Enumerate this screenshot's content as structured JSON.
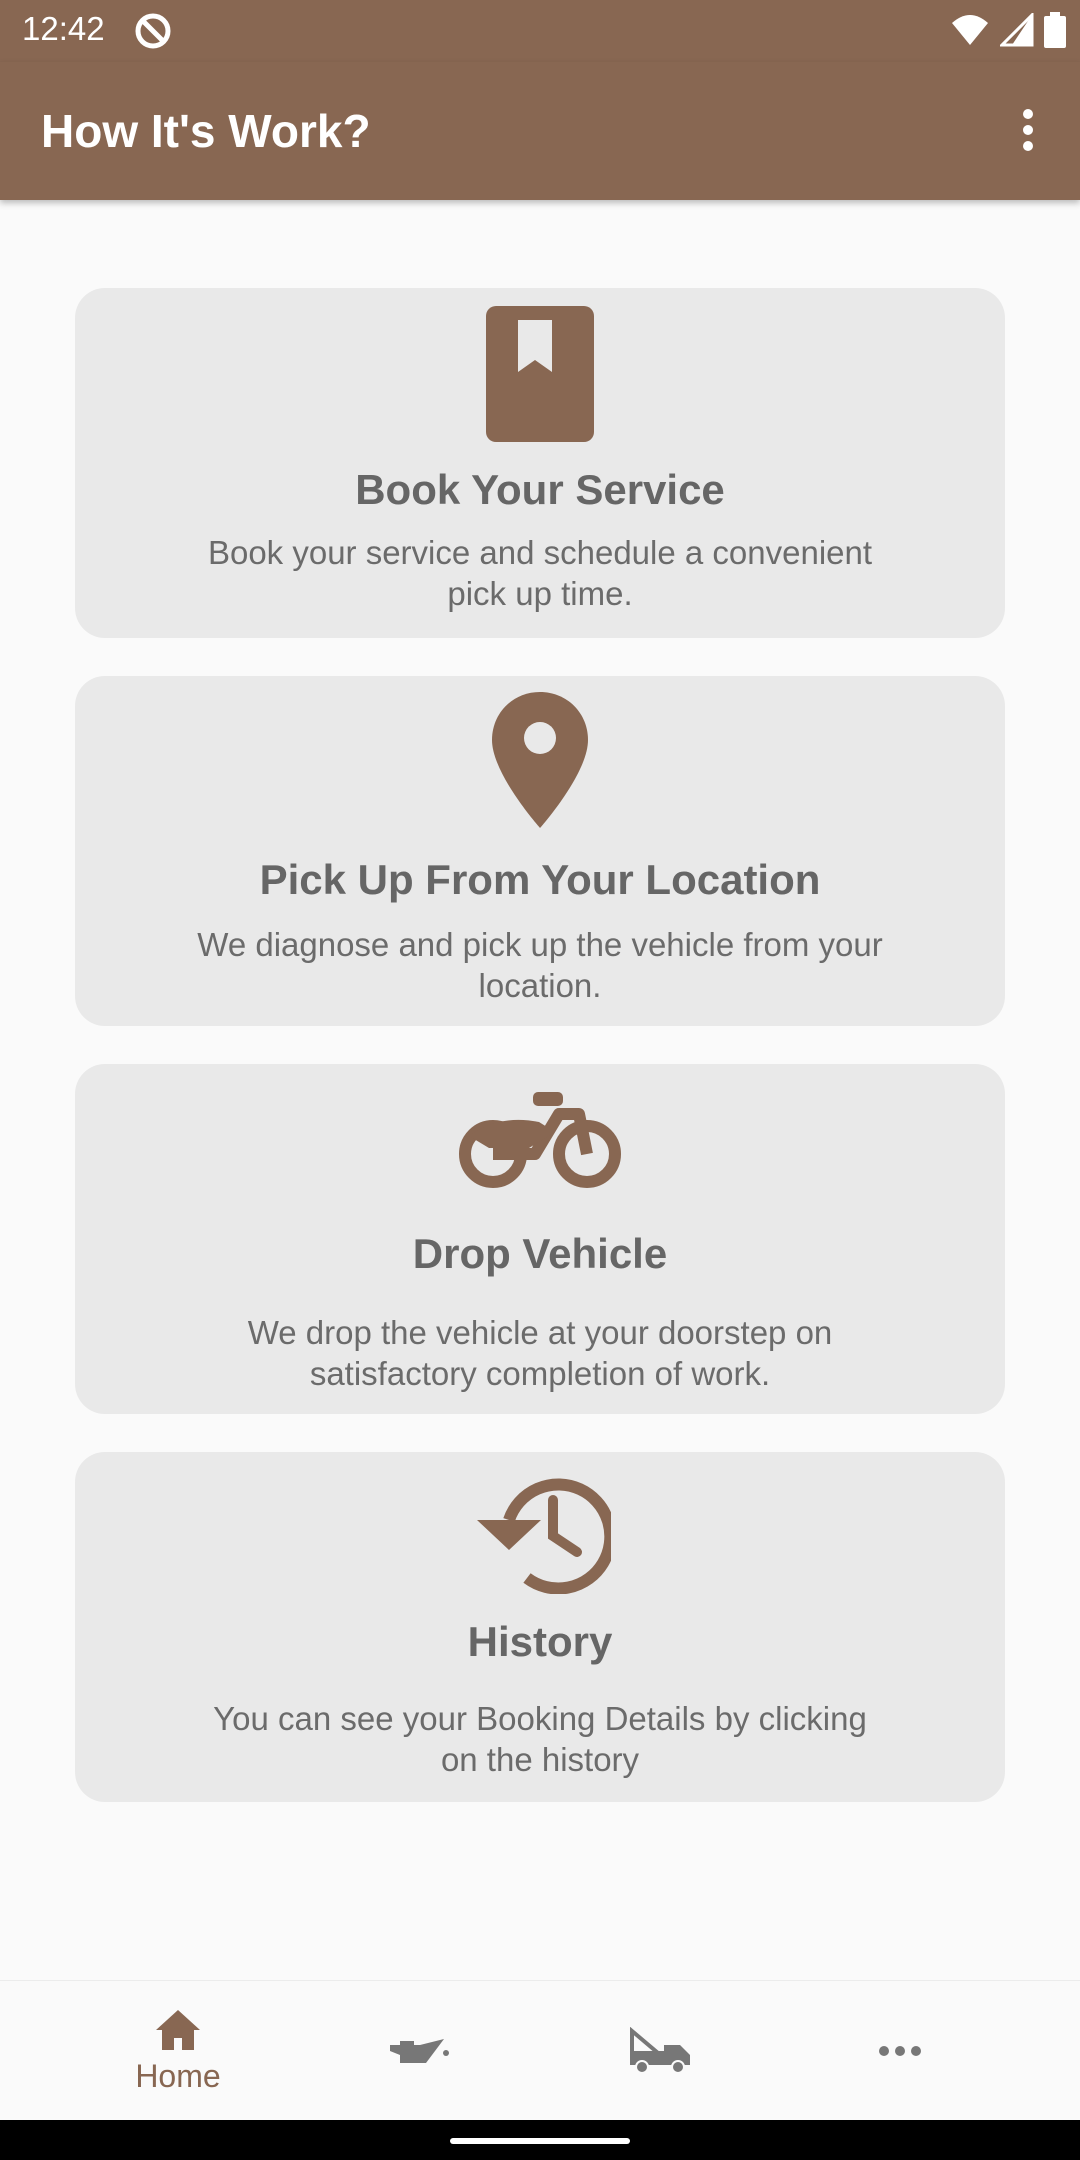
{
  "status_bar": {
    "time": "12:42",
    "icons": [
      "no-disturb-icon",
      "wifi-icon",
      "signal-icon",
      "battery-icon"
    ]
  },
  "app_bar": {
    "title": "How It's Work?",
    "menu_icon": "more-vert-icon"
  },
  "cards": [
    {
      "icon": "bookmark-book-icon",
      "title": "Book Your Service",
      "description": "Book your service and schedule a convenient pick up time."
    },
    {
      "icon": "location-pin-icon",
      "title": "Pick Up From Your Location",
      "description": "We diagnose and pick up the vehicle from your location."
    },
    {
      "icon": "motorcycle-icon",
      "title": "Drop Vehicle",
      "description": "We drop the vehicle at your doorstep on satisfactory completion of work."
    },
    {
      "icon": "history-icon",
      "title": "History",
      "description": "You can see your Booking Details by clicking on the history"
    }
  ],
  "bottom_nav": {
    "items": [
      {
        "icon": "home-icon",
        "label": "Home",
        "active": true
      },
      {
        "icon": "oil-can-icon",
        "label": "",
        "active": false
      },
      {
        "icon": "tow-truck-icon",
        "label": "",
        "active": false
      },
      {
        "icon": "more-horiz-icon",
        "label": "",
        "active": false
      }
    ]
  },
  "colors": {
    "primary": "#886752",
    "card_bg": "#e9e9e9",
    "title_text": "#666666",
    "body_text": "#6b6b6b"
  }
}
